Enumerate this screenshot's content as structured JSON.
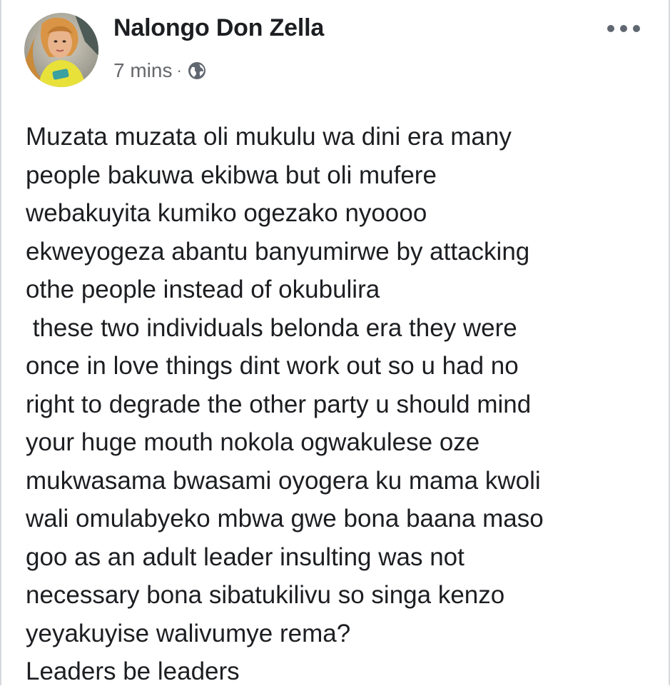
{
  "post": {
    "author": "Nalongo Don Zella",
    "time": "7 mins",
    "separator": "·",
    "privacy_icon": "globe-icon",
    "more_icon": "more-options-icon",
    "lines": [
      "Muzata muzata oli mukulu wa dini era many",
      "people bakuwa ekibwa but oli mufere",
      "webakuyita kumiko ogezako nyoooo",
      "ekweyogeza abantu banyumirwe by attacking",
      "othe people instead of okubulira",
      " these two individuals belonda era they were",
      "once in love things dint work out so u had no",
      "right to degrade the other party u should mind",
      "your huge mouth nokola ogwakulese oze",
      "mukwasama bwasami oyogera ku mama kwoli",
      "wali omulabyeko mbwa gwe bona baana maso",
      "goo as an adult leader insulting was not",
      "necessary bona sibatukilivu so singa kenzo",
      "yeyakuyise walivumye rema?",
      "Leaders be leaders"
    ]
  },
  "colors": {
    "text": "#1c1e21",
    "secondary_text": "#65676b",
    "icon_gray": "#606770",
    "background": "#ffffff"
  }
}
